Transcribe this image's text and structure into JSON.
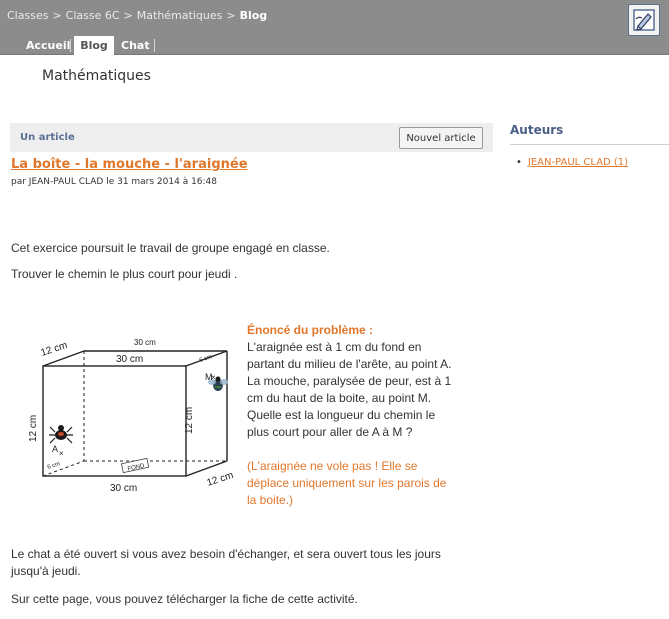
{
  "breadcrumb": {
    "items": [
      "Classes",
      "Classe 6C",
      "Mathématiques"
    ],
    "current": "Blog",
    "separator": ">"
  },
  "toolbar": {
    "tool_icon": "pen-edit-icon"
  },
  "tabs": [
    {
      "label": "Accueil",
      "active": false
    },
    {
      "label": "Blog",
      "active": true
    },
    {
      "label": "Chat",
      "active": false
    }
  ],
  "page": {
    "title": "Mathématiques"
  },
  "article_list": {
    "header_label": "Un article",
    "new_button": "Nouvel article"
  },
  "article": {
    "title": "La boîte - la mouche - l'araignée",
    "meta": "par JEAN-PAUL CLAD le 31 mars 2014 à 16:48",
    "p1": "Cet exercice poursuit le travail de groupe engagé en classe.",
    "p2": "Trouver le chemin le plus court pour jeudi .",
    "p3_line1": "Le chat a été ouvert si vous avez besoin d'échanger, et sera ouvert tous les jours",
    "p3_line2": "jusqu'à jeudi.",
    "p4": "Sur cette page,  vous pouvez télécharger la fiche de cette activité."
  },
  "figure": {
    "label_top_30": "30 cm",
    "label_top_12": "12 cm",
    "label_front_30": "30 cm",
    "label_bottom_30": "30 cm",
    "label_left_12": "12 cm",
    "label_right_12": "12 cm",
    "label_depth_12": "12 cm",
    "label_6_top": "6 cm",
    "label_6_bottom": "6 cm",
    "label_fond": "FOND",
    "point_a": "A",
    "point_m": "M"
  },
  "enonce": {
    "title": "Énoncé du problème :",
    "l1": "L'araignée est à 1 cm du fond en",
    "l2": "partant du milieu de l'arête, au point A.",
    "l3": "La mouche, paralysée de peur, est à 1",
    "l4": "cm du haut de la boite, au point M.",
    "l5": "Quelle est la longueur du chemin le",
    "l6": "plus court pour aller de A à M ?",
    "n1": "(L'araignée ne vole pas ! Elle se",
    "n2": "déplace uniquement sur les parois de",
    "n3": "la boite.)"
  },
  "sidebar": {
    "title": "Auteurs",
    "authors": [
      "JEAN-PAUL CLAD (1)"
    ]
  },
  "colors": {
    "accent": "#e0772b",
    "nav_gray": "#8c8c8c",
    "header_blue": "#4a5e86"
  }
}
